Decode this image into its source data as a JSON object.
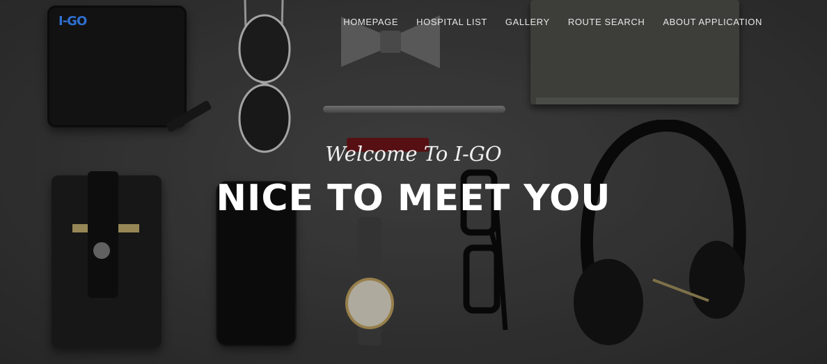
{
  "brand": {
    "logo_text": "I-GO"
  },
  "nav": {
    "items": [
      {
        "label": "HOMEPAGE"
      },
      {
        "label": "HOSPITAL LIST"
      },
      {
        "label": "GALLERY"
      },
      {
        "label": "ROUTE SEARCH"
      },
      {
        "label": "ABOUT APPLICATION"
      }
    ]
  },
  "hero": {
    "welcome": "Welcome To I-GO",
    "headline": "NICE TO MEET YOU"
  },
  "colors": {
    "logo": "#2f6fd0",
    "text": "#ffffff",
    "background": "#3a3a3a"
  }
}
